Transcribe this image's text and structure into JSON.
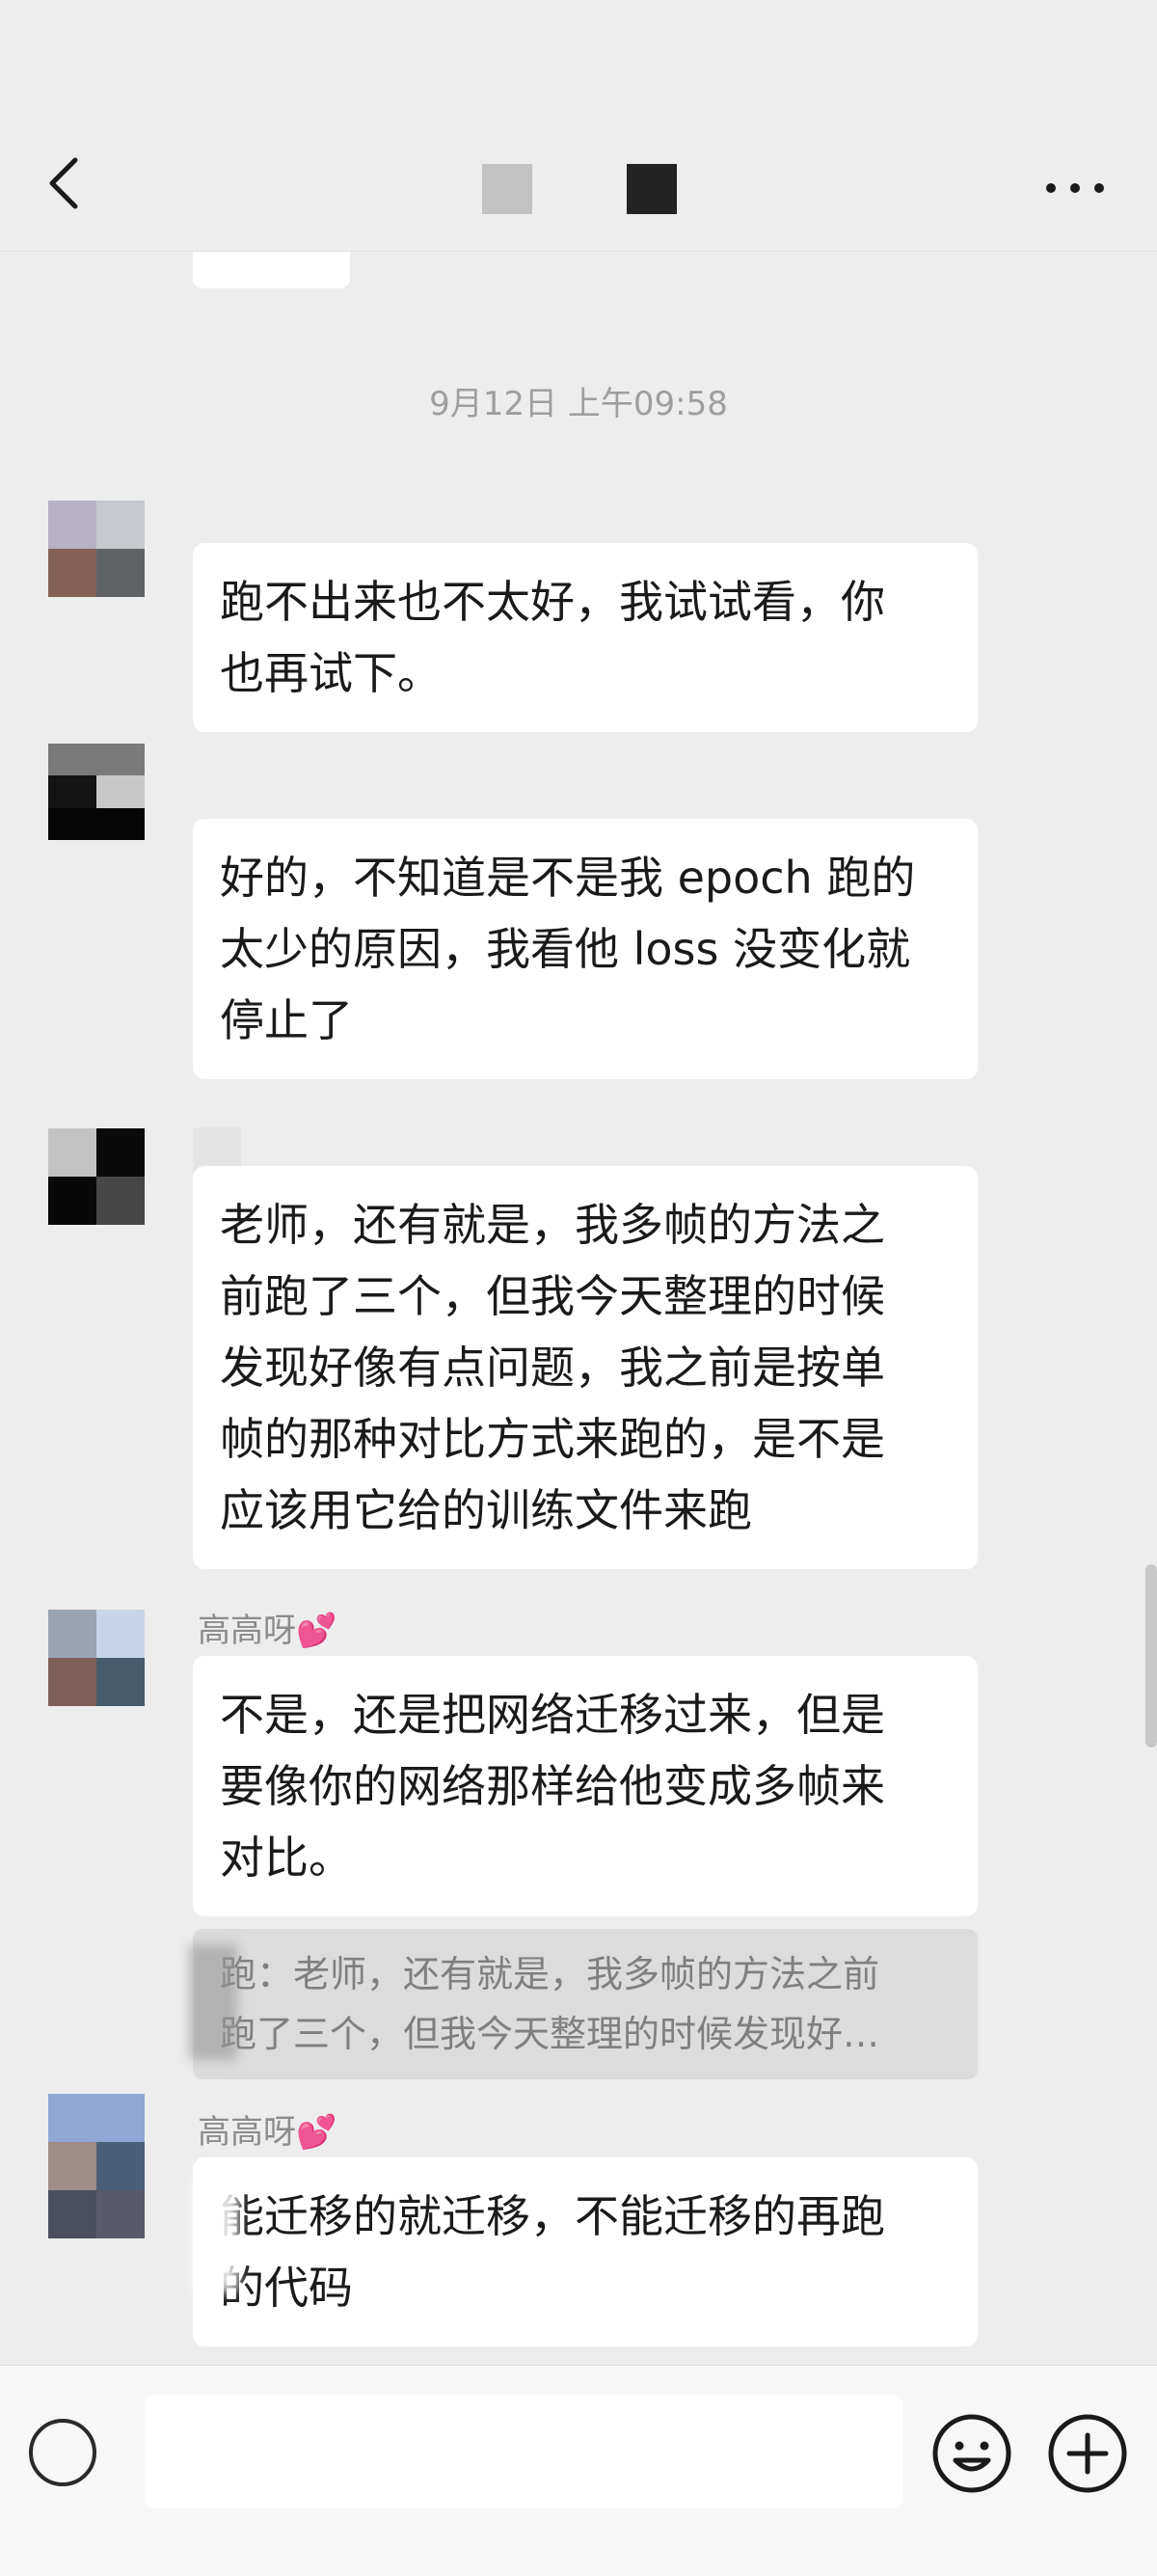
{
  "header": {
    "back_icon": "chevron-left-icon",
    "more_icon": "more-horizontal-icon"
  },
  "chat": {
    "timestamp": "9月12日 上午09:58",
    "messages": [
      {
        "lines": [
          "跑不出来也不太好，我试试看，你",
          "也再试下。"
        ]
      },
      {
        "lines": [
          "好的，不知道是不是我 epoch 跑的",
          "太少的原因，我看他 loss 没变化就",
          "停止了"
        ]
      },
      {
        "lines": [
          "老师，还有就是，我多帧的方法之",
          "前跑了三个，但我今天整理的时候",
          "发现好像有点问题，我之前是按单",
          "帧的那种对比方式来跑的，是不是",
          "应该用它给的训练文件来跑"
        ]
      },
      {
        "sender": "高高呀💕",
        "lines": [
          "不是，还是把网络迁移过来，但是",
          "要像你的网络那样给他变成多帧来",
          "对比。"
        ]
      },
      {
        "sender": "高高呀💕",
        "lines": [
          "能迁移的就迁移，不能迁移的再跑",
          "的代码"
        ]
      }
    ],
    "quote": {
      "lines": [
        "跑：老师，还有就是，我多帧的方法之前",
        "跑了三个，但我今天整理的时候发现好…"
      ]
    }
  },
  "input": {
    "voice_icon": "voice-icon",
    "emoji_icon": "emoji-icon",
    "plus_icon": "plus-circle-icon"
  }
}
